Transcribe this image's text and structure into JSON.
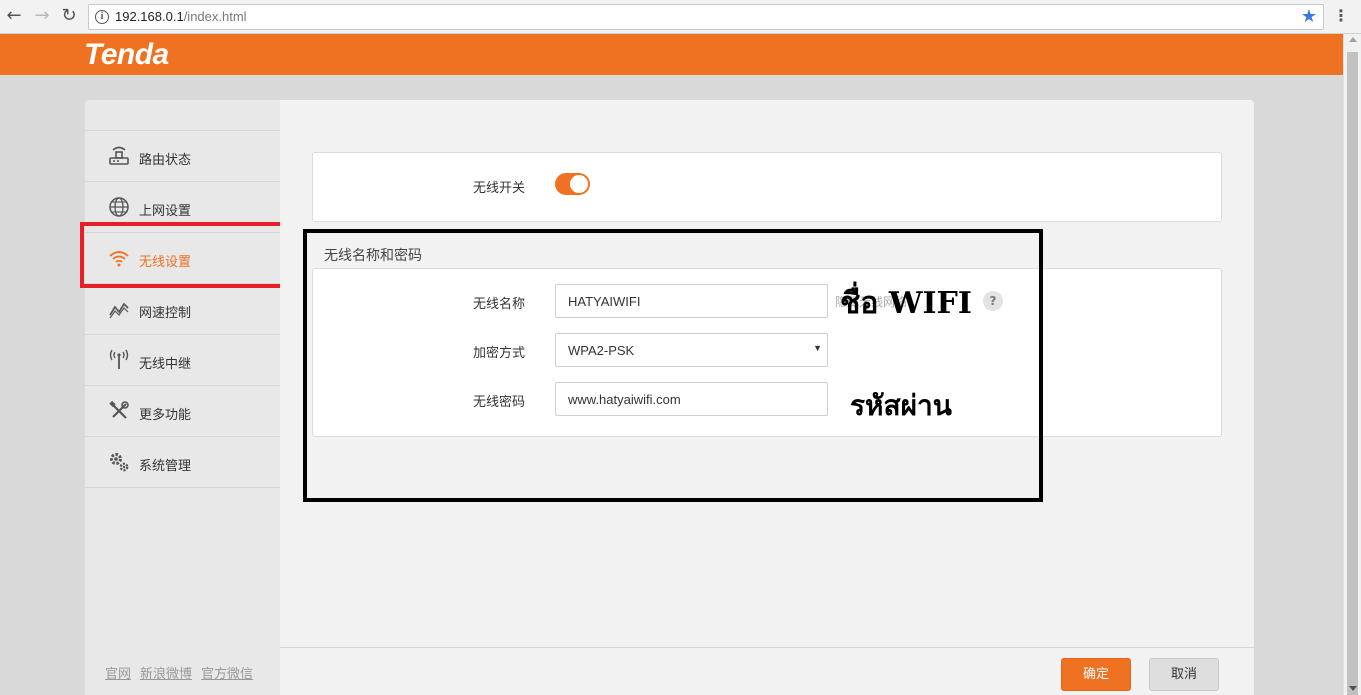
{
  "browser": {
    "url_host": "192.168.0.1",
    "url_path": "/index.html"
  },
  "brand": {
    "logo": "Tenda",
    "color": "#ef7223"
  },
  "sidebar": {
    "items": [
      {
        "label": "路由状态",
        "icon": "router-icon"
      },
      {
        "label": "上网设置",
        "icon": "globe-icon"
      },
      {
        "label": "无线设置",
        "icon": "wifi-icon",
        "active": true
      },
      {
        "label": "网速控制",
        "icon": "speed-chart-icon"
      },
      {
        "label": "无线中继",
        "icon": "antenna-icon"
      },
      {
        "label": "更多功能",
        "icon": "tools-icon"
      },
      {
        "label": "系统管理",
        "icon": "gears-icon"
      }
    ],
    "footer": [
      "官网",
      "新浪微博",
      "官方微信"
    ]
  },
  "wireless": {
    "switch_label": "无线开关",
    "switch_on": true,
    "section_title": "无线名称和密码",
    "ssid_label": "无线名称",
    "ssid_value": "HATYAIWIFI",
    "hide_label": "隐藏无线网络",
    "security_label": "加密方式",
    "security_value": "WPA2-PSK",
    "password_label": "无线密码",
    "password_value": "www.hatyaiwifi.com"
  },
  "annotations": {
    "ssid_note": "ชื่อ WIFI",
    "password_note": "รหัสผ่าน"
  },
  "actions": {
    "ok": "确定",
    "cancel": "取消"
  }
}
